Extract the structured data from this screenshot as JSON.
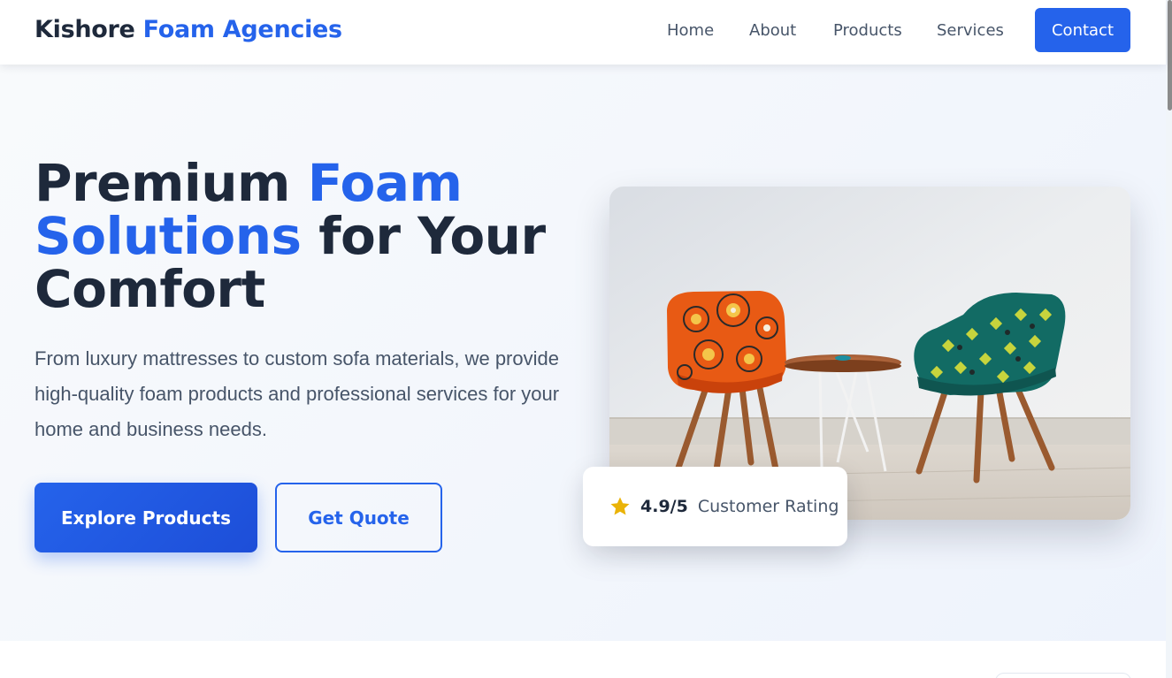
{
  "brand": {
    "name_part1": "Kishore",
    "name_part2": "Foam Agencies"
  },
  "nav": {
    "items": [
      {
        "label": "Home"
      },
      {
        "label": "About"
      },
      {
        "label": "Products"
      },
      {
        "label": "Services"
      }
    ],
    "contact_label": "Contact"
  },
  "hero": {
    "headline": {
      "line1_plain": "Premium",
      "line1_accent": "Foam",
      "line2_accent": "Solutions",
      "line2_plain": "for Your",
      "line3_plain": "Comfort"
    },
    "description": "From luxury mattresses to custom sofa materials, we provide high-quality foam products and professional services for your home and business needs.",
    "primary_button": "Explore Products",
    "secondary_button": "Get Quote",
    "image_icon": "chairs-photo",
    "rating": {
      "icon": "star-icon",
      "score": "4.9/5",
      "label": "Customer Rating"
    }
  },
  "colors": {
    "accent": "#2563eb",
    "text_dark": "#1e293b",
    "text_muted": "#475569",
    "star": "#eab308"
  }
}
